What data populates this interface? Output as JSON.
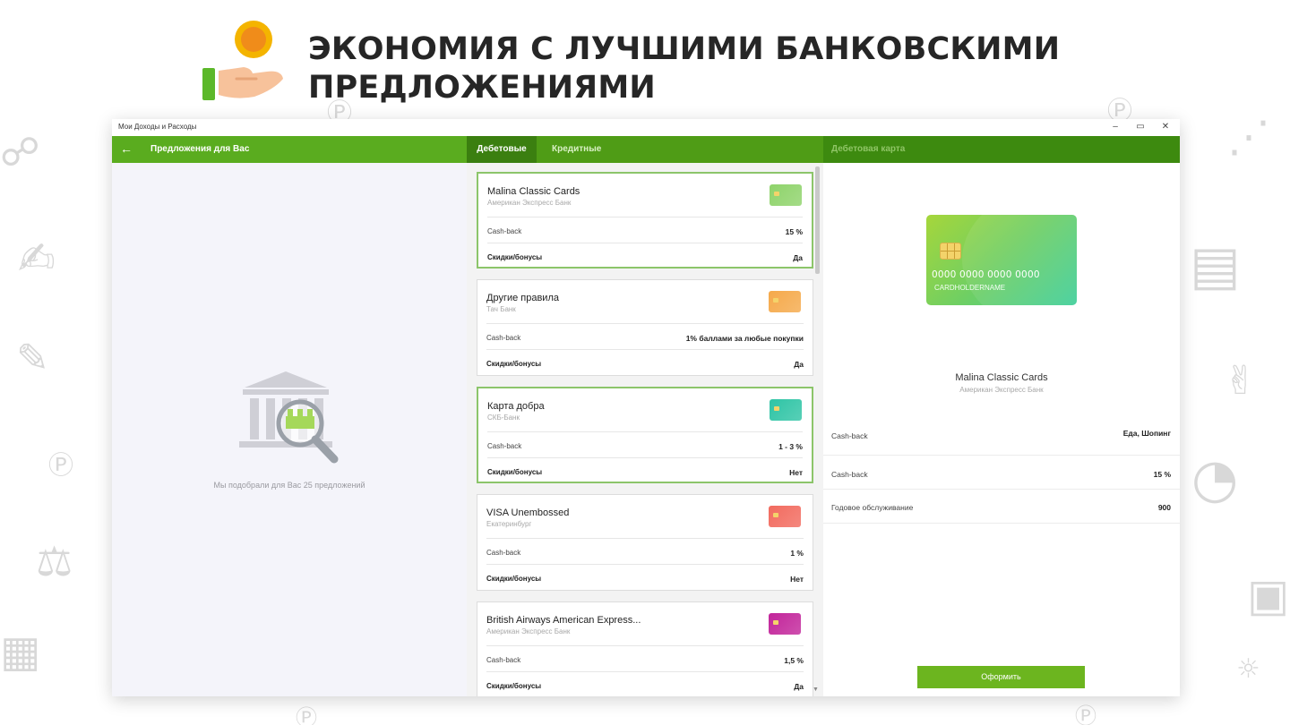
{
  "slide": {
    "title_line1": "ЭКОНОМИЯ С ЛУЧШИМИ БАНКОВСКИМИ",
    "title_line2": "ПРЕДЛОЖЕНИЯМИ"
  },
  "window": {
    "title": "Мои Доходы и Расходы",
    "minimize": "–",
    "maximize": "▭",
    "close": "✕"
  },
  "left_pane": {
    "back_icon": "arrow-left-icon",
    "title": "Предложения для Вас",
    "status_text": "Мы подобрали для Вас 25 предложений"
  },
  "tabs": [
    {
      "label": "Дебетовые",
      "active": true
    },
    {
      "label": "Кредитные",
      "active": false
    }
  ],
  "offers": [
    {
      "name": "Malina Classic Cards",
      "bank": "Американ Экспресс Банк",
      "row1_label": "Cash-back",
      "row1_value": "15 %",
      "row2_label": "Скидки/бонусы",
      "row2_value": "Да",
      "card_color": "#8ed36a",
      "selected": true
    },
    {
      "name": "Другие правила",
      "bank": "Тач Банк",
      "row1_label": "Cash-back",
      "row1_value": "1% баллами за любые покупки",
      "row2_label": "Скидки/бонусы",
      "row2_value": "Да",
      "card_color": "#f5a94a",
      "selected": false
    },
    {
      "name": "Карта добра",
      "bank": "СКБ-Банк",
      "row1_label": "Cash-back",
      "row1_value": "1 - 3 %",
      "row2_label": "Скидки/бонусы",
      "row2_value": "Нет",
      "card_color": "#2ec4a5",
      "selected": true
    },
    {
      "name": "VISA Unembossed",
      "bank": "Екатеринбург",
      "row1_label": "Cash-back",
      "row1_value": "1 %",
      "row2_label": "Скидки/бонусы",
      "row2_value": "Нет",
      "card_color": "#f26a5e",
      "selected": false
    },
    {
      "name": "British Airways American Express...",
      "bank": "Американ Экспресс Банк",
      "row1_label": "Cash-back",
      "row1_value": "1,5 %",
      "row2_label": "Скидки/бонусы",
      "row2_value": "Да",
      "card_color": "#c2249a",
      "selected": false
    }
  ],
  "detail": {
    "header": "Дебетовая карта",
    "card_number": "0000 0000 0000 0000",
    "card_holder": "CARDHOLDERNAME",
    "name": "Malina Classic Cards",
    "bank": "Американ Экспресс Банк",
    "rows": [
      {
        "label": "Cash-back",
        "value": "Еда, Шопинг"
      },
      {
        "label": "Cash-back",
        "value": "15 %"
      },
      {
        "label": "Годовое обслуживание",
        "value": "900"
      }
    ],
    "apply_label": "Оформить"
  },
  "colors": {
    "accent_green": "#5aac1f",
    "tab_active": "#3b7f10",
    "button_green": "#6cb51f"
  }
}
